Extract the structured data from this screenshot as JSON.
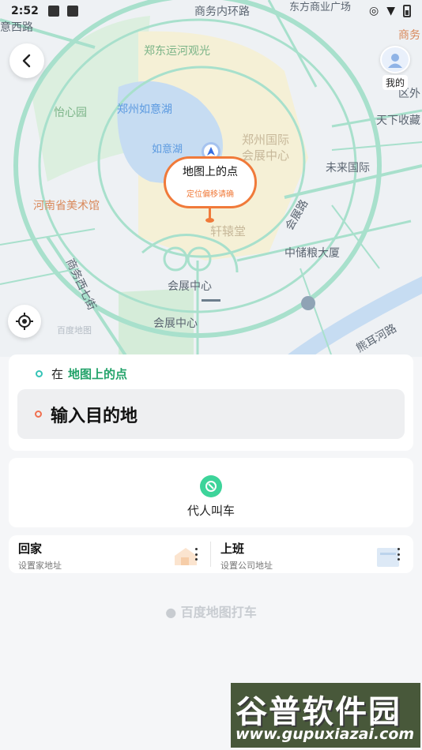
{
  "status_bar": {
    "time": "2:52"
  },
  "map": {
    "labels": {
      "road_north": "商务内环路",
      "road_west_top": "意西路",
      "canal": "郑东运河观光",
      "park": "怡心园",
      "lake": "郑州如意湖",
      "lake_small": "如意湖",
      "expo_line1": "郑州国际",
      "expo_line2": "会展中心",
      "museum": "河南省美术馆",
      "xuanyuan": "轩辕堂",
      "future": "未来国际",
      "huizhan_road": "会展路",
      "zhongchu": "中储粮大厦",
      "huizhan_center1": "会展中心",
      "huizhan_center2": "会展中心",
      "business_west": "商务西七街",
      "xiong_er": "熊耳河路",
      "tianxia": "天下收藏",
      "shangwu": "商务",
      "quwai": "区外",
      "dongfang": "东方商业广场",
      "map_brand": "百度地图"
    }
  },
  "pin": {
    "title": "地图上的点",
    "subtitle": "定位偏移请确"
  },
  "me_button": {
    "label": "我的"
  },
  "route": {
    "from_prefix": "在",
    "from_place": "地图上的点",
    "destination_placeholder": "输入目的地"
  },
  "proxy_call": {
    "label": "代人叫车"
  },
  "addresses": {
    "home": {
      "title": "回家",
      "subtitle": "设置家地址"
    },
    "work": {
      "title": "上班",
      "subtitle": "设置公司地址"
    }
  },
  "brand_footer": "百度地图打车",
  "watermark": {
    "title": "谷普软件园",
    "url": "www.gupuxiazai.com"
  },
  "colors": {
    "accent_green": "#23a36a",
    "accent_orange": "#f07a3a",
    "map_road": "#a8e0cc"
  },
  "icons": [
    "back-arrow-icon",
    "locate-icon",
    "avatar-icon",
    "proxy-call-icon",
    "kebab-icon",
    "location-arrow-icon",
    "wifi-icon",
    "battery-icon"
  ]
}
